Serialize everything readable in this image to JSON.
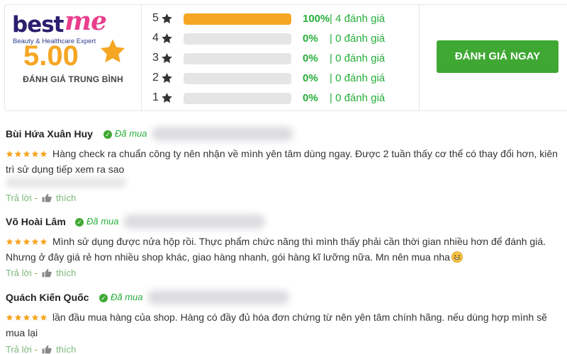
{
  "brand": {
    "logo_best": "best",
    "logo_me": "me",
    "logo_tagline": "Beauty & Healthcare Expert"
  },
  "summary": {
    "average": "5.00",
    "average_label": "ĐÁNH GIÁ TRUNG BÌNH",
    "rows": [
      {
        "stars": "5",
        "fraction": 1.0,
        "percent": "100%",
        "count": "| 4 đánh giá"
      },
      {
        "stars": "4",
        "fraction": 0.0,
        "percent": "0%",
        "count": "| 0 đánh giá"
      },
      {
        "stars": "3",
        "fraction": 0.0,
        "percent": "0%",
        "count": "| 0 đánh giá"
      },
      {
        "stars": "2",
        "fraction": 0.0,
        "percent": "0%",
        "count": "| 0 đánh giá"
      },
      {
        "stars": "1",
        "fraction": 0.0,
        "percent": "0%",
        "count": "| 0 đánh giá"
      }
    ],
    "cta_label": "ĐÁNH GIÁ NGAY"
  },
  "reviews": [
    {
      "name": "Bùi Hứa Xuân Huy",
      "verified": "Đã mua",
      "rating": 5,
      "text": "Hàng check ra chuẩn công ty nên nhận về mình yên tâm dùng ngay. Được 2 tuần thấy cơ thể có thay đổi hơn, kiên trì sử dụng tiếp xem ra sao",
      "reply_label": "Trả lời",
      "like_label": "thích"
    },
    {
      "name": "Võ Hoài Lâm",
      "verified": "Đã mua",
      "rating": 5,
      "text": "Mình sử dụng được nửa hộp rồi. Thực phẩm chức năng thì mình thấy phải cần thời gian nhiều hơn để đánh giá. Nhưng ở đây giá rẻ hơn nhiều shop khác, giao hàng nhanh, gói hàng kĩ lưỡng nữa. Mn nên mua nha",
      "reply_label": "Trả lời",
      "like_label": "thích"
    },
    {
      "name": "Quách Kiến Quốc",
      "verified": "Đã mua",
      "rating": 5,
      "text": "lần đầu mua hàng của shop. Hàng có đầy đủ hóa đơn chứng từ nên yên tâm chính hãng. nếu dùng hợp mình sẽ mua lại",
      "reply_label": "Trả lời",
      "like_label": "thích"
    }
  ],
  "colors": {
    "star": "#f5a623",
    "green": "#3fa833",
    "bar_bg": "#e5e5e5"
  },
  "icons": {
    "star": "star-icon",
    "check": "check-circle-icon",
    "like": "thumbs-up-icon",
    "emoji": "grinning-face-emoji"
  }
}
